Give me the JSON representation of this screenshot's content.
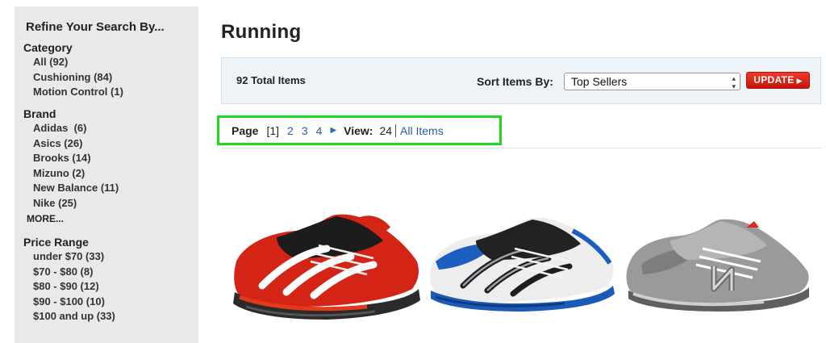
{
  "sidebar": {
    "title": "Refine Your Search By...",
    "category": {
      "heading": "Category",
      "items": [
        "All (92)",
        "Cushioning (84)",
        "Motion Control (1)"
      ]
    },
    "brand": {
      "heading": "Brand",
      "items": [
        "Adidas  (6)",
        "Asics (26)",
        "Brooks (14)",
        "Mizuno (2)",
        "New Balance (11)",
        "Nike (25)"
      ],
      "more": "MORE..."
    },
    "price": {
      "heading": "Price Range",
      "items": [
        "under $70 (33)",
        "$70 - $80 (8)",
        "$80 - $90 (12)",
        "$90 - $100 (10)",
        "$100 and up (33)"
      ]
    }
  },
  "main": {
    "title": "Running",
    "toolbar": {
      "total": "92 Total Items",
      "sort_label": "Sort Items By:",
      "sort_value": "Top Sellers",
      "update_label": "UPDATE"
    },
    "pager": {
      "page_label": "Page",
      "current": "[1]",
      "pages": [
        "2",
        "3",
        "4"
      ],
      "view_label": "View:",
      "view_value": "24",
      "all_items": "All Items"
    }
  },
  "colors": {
    "highlight": "#1ed81e",
    "link": "#1f5fa8",
    "update": "#d9200f",
    "sidebar_bg": "#e9e9e9",
    "toolbar_bg": "#eef3f8"
  },
  "products": [
    {
      "image": "shoe-red-black-icon"
    },
    {
      "image": "shoe-white-blue-icon"
    },
    {
      "image": "shoe-gray-icon"
    }
  ]
}
